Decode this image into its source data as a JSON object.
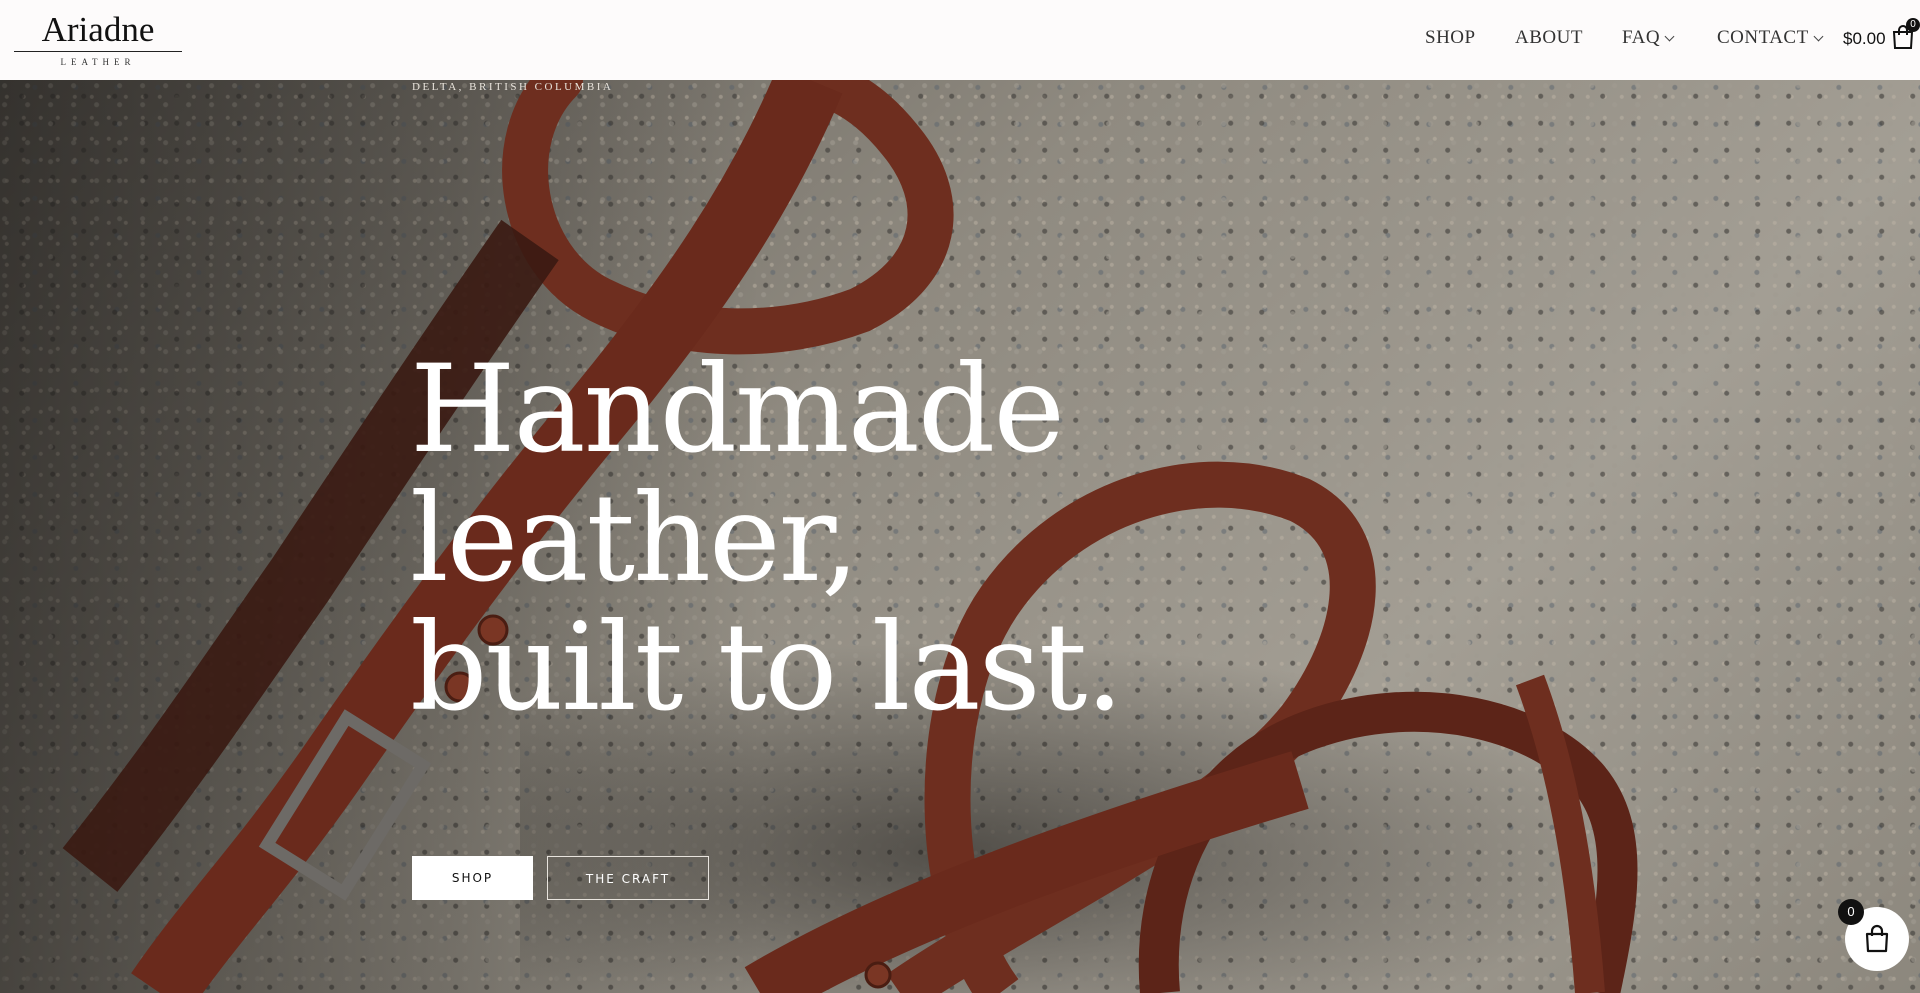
{
  "brand": {
    "name": "Ariadne",
    "tagline": "LEATHER"
  },
  "nav": {
    "items": [
      {
        "label": "SHOP"
      },
      {
        "label": "ABOUT"
      },
      {
        "label": "FAQ"
      },
      {
        "label": "CONTACT"
      }
    ]
  },
  "cart": {
    "total": "$0.00",
    "count": "0"
  },
  "hero": {
    "location": "DELTA, BRITISH COLUMBIA",
    "headline": [
      "Handmade",
      "leather,",
      "built to last."
    ],
    "primary_button": "SHOP",
    "secondary_button": "THE CRAFT"
  },
  "floating_cart": {
    "count": "0",
    "icon": "shopping-bag-icon"
  },
  "colors": {
    "header_bg": "#fdfbfb",
    "text_dark": "#111111",
    "leather": "#6e2e1f",
    "hero_text": "#ffffff"
  }
}
